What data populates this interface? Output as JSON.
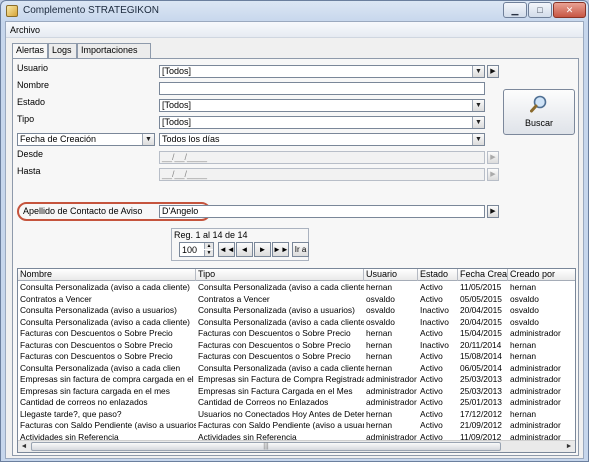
{
  "window": {
    "title": "Complemento STRATEGIKON",
    "minimize": "▁",
    "maximize": "□",
    "close": "✕"
  },
  "menu": {
    "archivo": "Archivo"
  },
  "tabs": [
    "Alertas",
    "Logs",
    "Importaciones"
  ],
  "filters": {
    "usuario_label": "Usuario",
    "usuario_value": "[Todos]",
    "nombre_label": "Nombre",
    "nombre_value": "",
    "estado_label": "Estado",
    "estado_value": "[Todos]",
    "tipo_label": "Tipo",
    "tipo_value": "[Todos]",
    "date_field_value": "Fecha de Creación",
    "date_range_value": "Todos los días",
    "desde_label": "Desde",
    "desde_value": "__/__/____",
    "hasta_label": "Hasta",
    "hasta_value": "__/__/____",
    "apellido_label": "Apellido de Contacto de Aviso",
    "apellido_value": "D'Angelo"
  },
  "buscar": {
    "label": "Buscar",
    "icon": "magnifier-icon"
  },
  "navigator": {
    "caption": "Reg. 1 al 14 de 14",
    "page_size": "100",
    "first": "◄◄",
    "prev": "◄",
    "next": "►",
    "last": "►►",
    "go": "Ir a"
  },
  "table": {
    "columns": [
      "Nombre",
      "Tipo",
      "Usuario",
      "Estado",
      "Fecha Creac",
      "Creado por"
    ],
    "rows": [
      [
        "Consulta Personalizada (aviso a cada cliente)",
        "Consulta Personalizada (aviso a cada cliente)",
        "hernan",
        "Activo",
        "11/05/2015",
        "hernan"
      ],
      [
        "Contratos a Vencer",
        "Contratos a Vencer",
        "osvaldo",
        "Activo",
        "05/05/2015",
        "osvaldo"
      ],
      [
        "Consulta Personalizada (aviso a usuarios)",
        "Consulta Personalizada (aviso a usuarios)",
        "osvaldo",
        "Inactivo",
        "20/04/2015",
        "osvaldo"
      ],
      [
        "Consulta Personalizada (aviso a cada cliente)",
        "Consulta Personalizada (aviso a cada cliente)",
        "osvaldo",
        "Inactivo",
        "20/04/2015",
        "osvaldo"
      ],
      [
        "Facturas con Descuentos o Sobre Precio",
        "Facturas con Descuentos o Sobre Precio",
        "hernan",
        "Activo",
        "15/04/2015",
        "administrador"
      ],
      [
        "Facturas con Descuentos o Sobre Precio",
        "Facturas con Descuentos o Sobre Precio",
        "hernan",
        "Inactivo",
        "20/11/2014",
        "hernan"
      ],
      [
        "Facturas con Descuentos o Sobre Precio",
        "Facturas con Descuentos o Sobre Precio",
        "hernan",
        "Activo",
        "15/08/2014",
        "hernan"
      ],
      [
        "Consulta Personalizada (aviso a cada clien",
        "Consulta Personalizada (aviso a cada cliente)",
        "hernan",
        "Activo",
        "06/05/2014",
        "administrador"
      ],
      [
        "Empresas sin factura de compra cargada en el me",
        "Empresas sin Factura de Compra Registrada en",
        "administrador",
        "Activo",
        "25/03/2013",
        "administrador"
      ],
      [
        "Empresas sin factura cargada en el mes",
        "Empresas sin Factura Cargada en el Mes",
        "administrador",
        "Activo",
        "25/03/2013",
        "administrador"
      ],
      [
        "Cantidad de correos no enlazados",
        "Cantidad de Correos no Enlazados",
        "administrador",
        "Activo",
        "25/01/2013",
        "administrador"
      ],
      [
        "Llegaste tarde?, que paso?",
        "Usuarios no Conectados Hoy Antes de Determi",
        "hernan",
        "Activo",
        "17/12/2012",
        "hernan"
      ],
      [
        "Facturas con Saldo Pendiente (aviso a usuarios)",
        "Facturas con Saldo Pendiente (aviso a usuarios)",
        "hernan",
        "Activo",
        "21/09/2012",
        "administrador"
      ],
      [
        "Actividades sin Referencia",
        "Actividades sin Referencia",
        "administrador",
        "Activo",
        "11/09/2012",
        "administrador"
      ]
    ]
  },
  "scrollbar": {
    "left": "◄",
    "right": "►",
    "grip": "|||"
  }
}
